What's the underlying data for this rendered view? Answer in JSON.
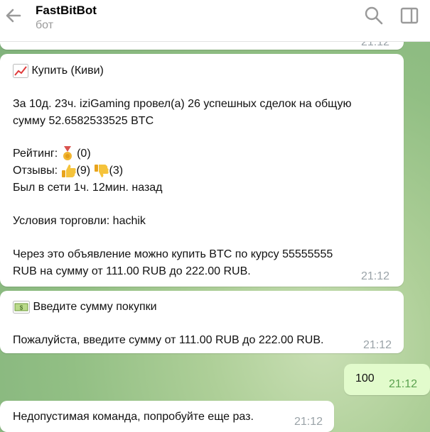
{
  "header": {
    "title": "FastBitBot",
    "subtitle": "бот"
  },
  "messages": {
    "prev": {
      "time": "21:12"
    },
    "offer": {
      "title": "Купить (Киви)",
      "line1": "За 10д. 23ч. iziGaming провел(а) 26 успешных сделок на общую",
      "line2": "сумму 52.6582533525 BTC",
      "rating_label": "Рейтинг:",
      "rating_value": "(0)",
      "reviews_label": "Отзывы:",
      "reviews_pos": "(9)",
      "reviews_neg": "(3)",
      "online": "Был в сети 1ч. 12мин.  назад",
      "terms": "Условия торговли: hachik",
      "rate_line1": "Через это объявление можно купить BTC по курсу 55555555",
      "rate_line2": "RUB на сумму от 111.00 RUB до 222.00 RUB.",
      "time": "21:12"
    },
    "amount": {
      "title": "Введите сумму покупки",
      "text": "Пожалуйста, введите сумму от 111.00 RUB до 222.00 RUB.",
      "time": "21:12"
    },
    "user": {
      "text": "100",
      "time": "21:12"
    },
    "error": {
      "text": "Недопустимая команда, попробуйте еще раз.",
      "time": "21:12"
    }
  },
  "icons": {
    "back": "back-arrow-icon",
    "search": "search-icon",
    "panel": "side-panel-icon",
    "chart": "chart-increasing-icon",
    "medal": "medal-icon",
    "thumbs_up": "thumbs-up-icon",
    "thumbs_down": "thumbs-down-icon",
    "money": "banknote-icon"
  }
}
